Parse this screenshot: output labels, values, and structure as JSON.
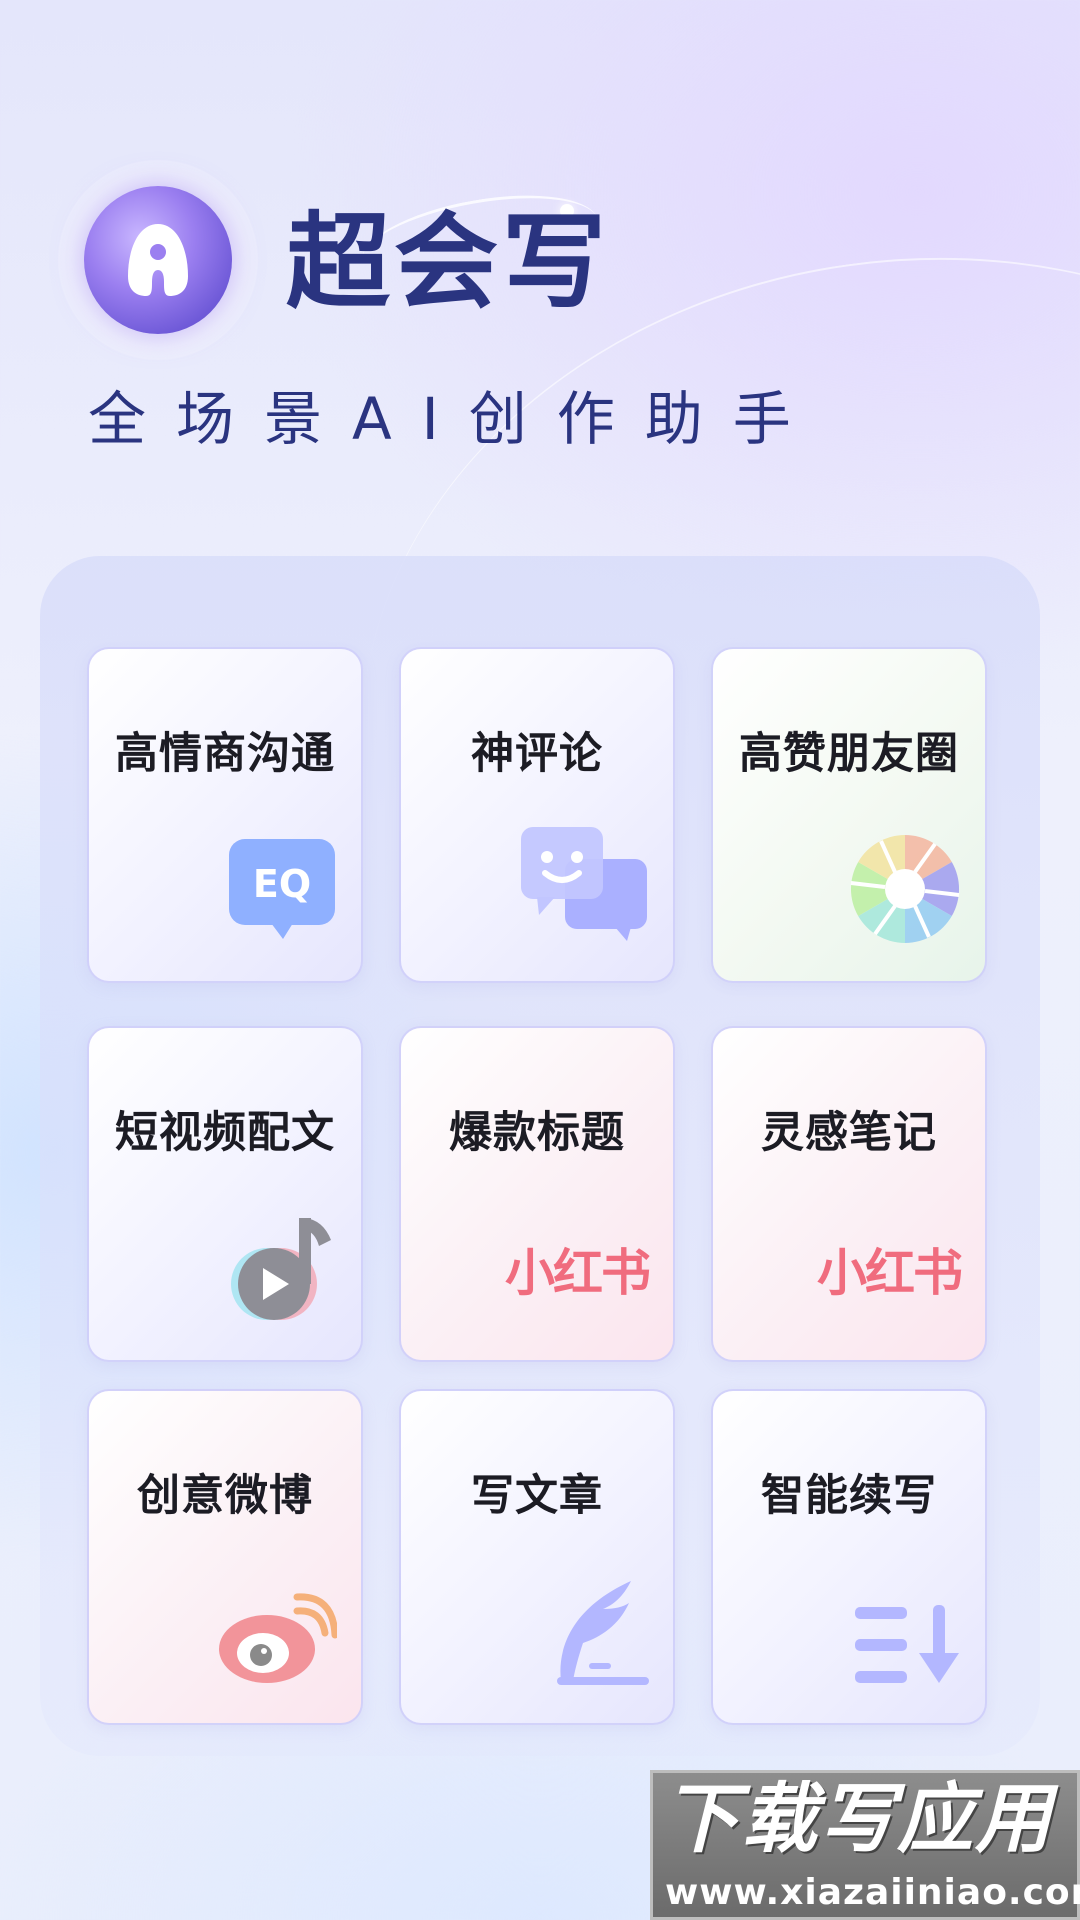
{
  "app": {
    "title": "超会写",
    "subtitle": "全场景AI创作助手"
  },
  "features": [
    {
      "label": "高情商沟通",
      "icon": "eq-chat-bubble-icon",
      "badge": "EQ"
    },
    {
      "label": "神评论",
      "icon": "chat-bubbles-icon"
    },
    {
      "label": "高赞朋友圈",
      "icon": "camera-aperture-icon"
    },
    {
      "label": "短视频配文",
      "icon": "tiktok-music-note-icon"
    },
    {
      "label": "爆款标题",
      "icon": "xiaohongshu-logo-icon",
      "logo_text": "小红书"
    },
    {
      "label": "灵感笔记",
      "icon": "xiaohongshu-logo-icon",
      "logo_text": "小红书"
    },
    {
      "label": "创意微博",
      "icon": "weibo-logo-icon"
    },
    {
      "label": "写文章",
      "icon": "quill-pen-icon"
    },
    {
      "label": "智能续写",
      "icon": "list-continue-arrow-icon"
    }
  ],
  "watermark": {
    "title": "下载写应用",
    "url": "www.xiazaiiniao.com"
  },
  "colors": {
    "brand_text": "#2a3480",
    "icon_purple": "#a9b0ff",
    "icon_blue": "#8fb0ff",
    "xhs_red": "#f06c7e"
  }
}
